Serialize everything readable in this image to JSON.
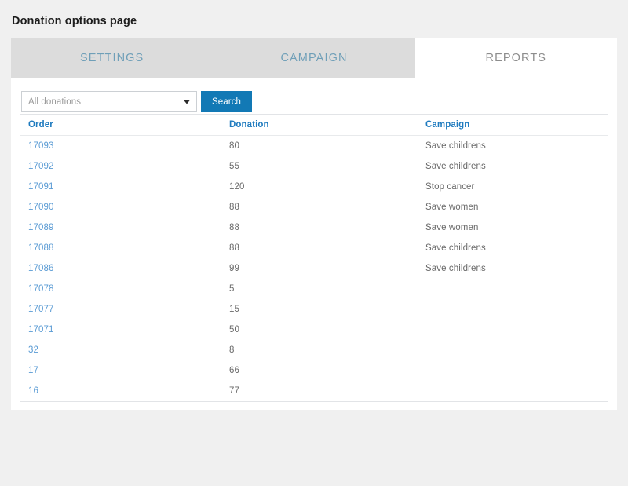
{
  "page": {
    "title": "Donation options page"
  },
  "tabs": [
    {
      "label": "SETTINGS",
      "active": false
    },
    {
      "label": "CAMPAIGN",
      "active": false
    },
    {
      "label": "REPORTS",
      "active": true
    }
  ],
  "toolbar": {
    "filter_selected": "All donations",
    "filter_options": [
      "All donations"
    ],
    "search_label": "Search",
    "dropdown_icon": "chevron-down-icon",
    "accent_color": "#1279b5"
  },
  "table": {
    "columns": [
      "Order",
      "Donation",
      "Campaign"
    ],
    "header_color": "#1f7bbf",
    "link_color": "#5a9bd4",
    "rows": [
      {
        "order": "17093",
        "donation": "80",
        "campaign": "Save childrens"
      },
      {
        "order": "17092",
        "donation": "55",
        "campaign": "Save childrens"
      },
      {
        "order": "17091",
        "donation": "120",
        "campaign": "Stop cancer"
      },
      {
        "order": "17090",
        "donation": "88",
        "campaign": "Save women"
      },
      {
        "order": "17089",
        "donation": "88",
        "campaign": "Save women"
      },
      {
        "order": "17088",
        "donation": "88",
        "campaign": "Save childrens"
      },
      {
        "order": "17086",
        "donation": "99",
        "campaign": "Save childrens"
      },
      {
        "order": "17078",
        "donation": "5",
        "campaign": ""
      },
      {
        "order": "17077",
        "donation": "15",
        "campaign": ""
      },
      {
        "order": "17071",
        "donation": "50",
        "campaign": ""
      },
      {
        "order": "32",
        "donation": "8",
        "campaign": ""
      },
      {
        "order": "17",
        "donation": "66",
        "campaign": ""
      },
      {
        "order": "16",
        "donation": "77",
        "campaign": ""
      }
    ]
  }
}
